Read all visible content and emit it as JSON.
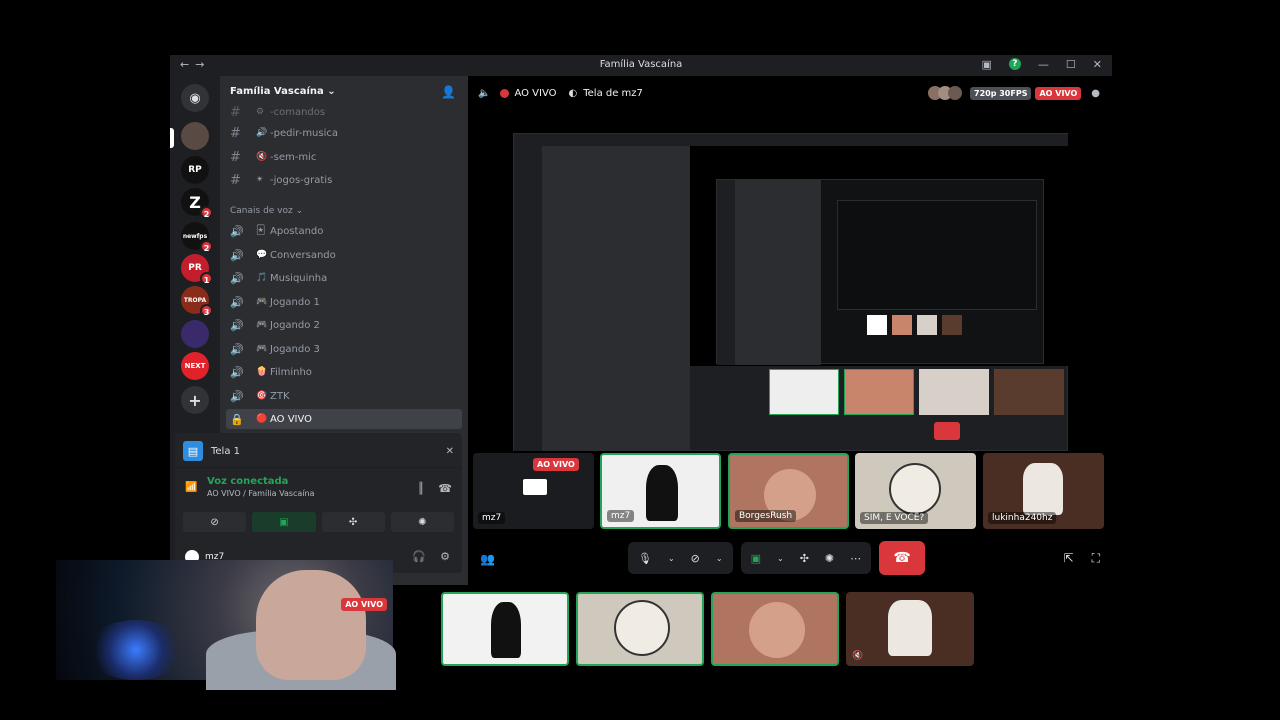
{
  "window": {
    "title": "Família Vascaína",
    "nav_back": "←",
    "nav_forward": "→",
    "controls": [
      "—",
      "☐",
      "✕"
    ],
    "help": "?"
  },
  "server_list": [
    {
      "label": "RP",
      "badge": ""
    },
    {
      "label": "Z",
      "badge": "2"
    },
    {
      "label": "newfps",
      "badge": "2"
    },
    {
      "label": "PR",
      "badge": "1"
    },
    {
      "label": "TROPA",
      "badge": "3"
    },
    {
      "label": "",
      "badge": ""
    },
    {
      "label": "NEXT",
      "badge": ""
    }
  ],
  "server": {
    "name": "Família Vascaína"
  },
  "channels": {
    "text": [
      {
        "name": "-comandos",
        "emoji": "⚙"
      },
      {
        "name": "-pedir-musica",
        "emoji": "🔊"
      },
      {
        "name": "-sem-mic",
        "emoji": "🔇"
      },
      {
        "name": "-jogos-gratis",
        "emoji": "✴"
      }
    ],
    "voice_category": "Canais de voz",
    "voice": [
      {
        "name": "Apostando",
        "emoji": "🃏"
      },
      {
        "name": "Conversando",
        "emoji": "💬"
      },
      {
        "name": "Musiquinha",
        "emoji": "🎵"
      },
      {
        "name": "Jogando 1",
        "emoji": "🎮"
      },
      {
        "name": "Jogando 2",
        "emoji": "🎮"
      },
      {
        "name": "Jogando 3",
        "emoji": "🎮"
      },
      {
        "name": "Filminho",
        "emoji": "🍿"
      },
      {
        "name": "ZTK",
        "emoji": "🎯"
      },
      {
        "name": "AO VIVO",
        "emoji": "🔴"
      }
    ]
  },
  "user_panel": {
    "screen_name": "Tela 1",
    "voice_status": "Voz conectada",
    "voice_location": "AO VIVO / Família Vascaína",
    "username": "mz7"
  },
  "stream_header": {
    "live": "AO VIVO",
    "screen_title": "Tela de mz7",
    "quality": "720p 30FPS",
    "live_badge": "AO VIVO"
  },
  "participants": [
    {
      "name": "mz7",
      "live": "AO VIVO"
    },
    {
      "name": "mz7"
    },
    {
      "name": "BorgesRush"
    },
    {
      "name": "SIM, E VOCÊ?"
    },
    {
      "name": "lukinha240hz"
    }
  ],
  "webcam_badge": "AO VIVO",
  "colors": {
    "accent_red": "#da373c",
    "accent_green": "#23a559",
    "bg": "#111214"
  }
}
